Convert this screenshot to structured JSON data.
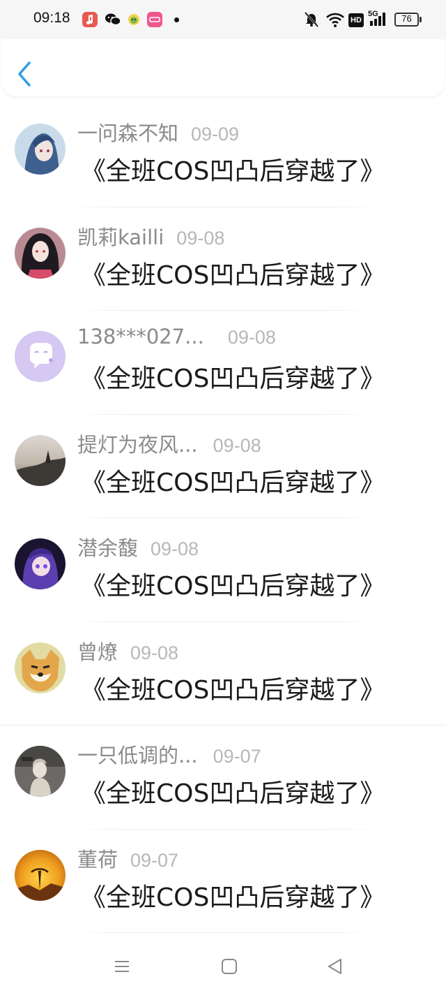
{
  "status_bar": {
    "time": "09:18",
    "app_icons": [
      "music-app-icon",
      "wechat-icon",
      "child-avatar-app-icon",
      "lofter-app-icon"
    ],
    "right_icons": [
      "bell-muted-icon",
      "wifi-icon",
      "hd-icon",
      "5g-signal-icon",
      "battery-icon"
    ],
    "hd_label": "HD",
    "network_label": "5G",
    "battery_level": "76"
  },
  "header": {
    "back_icon": "chevron-left-icon",
    "accent_color": "#2e9be6"
  },
  "items": [
    {
      "name": "一问森不知",
      "date": "09-09",
      "title": "《全班COS凹凸后穿越了》"
    },
    {
      "name": "凯莉kailli",
      "date": "09-08",
      "title": "《全班COS凹凸后穿越了》"
    },
    {
      "name": "138***027...",
      "date": "09-08",
      "title": "《全班COS凹凸后穿越了》"
    },
    {
      "name": "提灯为夜风...",
      "date": "09-08",
      "title": "《全班COS凹凸后穿越了》"
    },
    {
      "name": "潜余馥",
      "date": "09-08",
      "title": "《全班COS凹凸后穿越了》"
    },
    {
      "name": "曾燎",
      "date": "09-08",
      "title": "《全班COS凹凸后穿越了》"
    },
    {
      "name": "一只低调的...",
      "date": "09-07",
      "title": "《全班COS凹凸后穿越了》"
    },
    {
      "name": "董荷",
      "date": "09-07",
      "title": "《全班COS凹凸后穿越了》"
    }
  ],
  "nav_bar": {
    "icons": [
      "menu-icon",
      "home-square-icon",
      "back-triangle-icon"
    ]
  }
}
